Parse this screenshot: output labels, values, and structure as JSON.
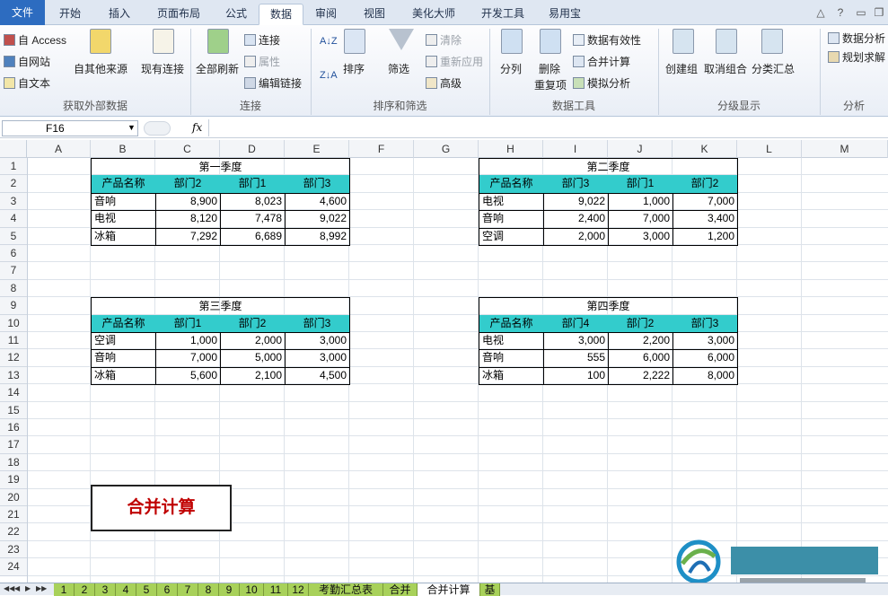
{
  "menu_tabs": [
    "文件",
    "开始",
    "插入",
    "页面布局",
    "公式",
    "数据",
    "审阅",
    "视图",
    "美化大师",
    "开发工具",
    "易用宝"
  ],
  "ribbon": {
    "ext": [
      "自 Access",
      "自网站",
      "自文本",
      "自其他来源",
      "现有连接"
    ],
    "conn": [
      "全部刷新",
      "连接",
      "属性",
      "编辑链接"
    ],
    "sort": [
      "排序",
      "筛选",
      "清除",
      "重新应用",
      "高级"
    ],
    "tools": [
      "分列",
      "删除",
      "重复项",
      "数据有效性",
      "合并计算",
      "模拟分析"
    ],
    "outline": [
      "创建组",
      "取消组合",
      "分类汇总"
    ],
    "analysis": [
      "数据分析",
      "规划求解"
    ],
    "groups": [
      "获取外部数据",
      "连接",
      "排序和筛选",
      "数据工具",
      "分级显示",
      "分析"
    ]
  },
  "name_box": "F16",
  "fx": "fx",
  "columns": [
    "A",
    "B",
    "C",
    "D",
    "E",
    "F",
    "G",
    "H",
    "I",
    "J",
    "K",
    "L",
    "M"
  ],
  "rows": [
    "1",
    "2",
    "3",
    "4",
    "5",
    "6",
    "7",
    "8",
    "9",
    "10",
    "11",
    "12",
    "13",
    "14",
    "15",
    "16",
    "17",
    "18",
    "19",
    "20",
    "21",
    "22",
    "23",
    "24"
  ],
  "tables": [
    {
      "title": "第一季度",
      "headers": [
        "产品名称",
        "部门2",
        "部门1",
        "部门3"
      ],
      "rows": [
        [
          "音响",
          "8,900",
          "8,023",
          "4,600"
        ],
        [
          "电视",
          "8,120",
          "7,478",
          "9,022"
        ],
        [
          "冰箱",
          "7,292",
          "6,689",
          "8,992"
        ]
      ]
    },
    {
      "title": "第二季度",
      "headers": [
        "产品名称",
        "部门3",
        "部门1",
        "部门2"
      ],
      "rows": [
        [
          "电视",
          "9,022",
          "1,000",
          "7,000"
        ],
        [
          "音响",
          "2,400",
          "7,000",
          "3,400"
        ],
        [
          "空调",
          "2,000",
          "3,000",
          "1,200"
        ]
      ]
    },
    {
      "title": "第三季度",
      "headers": [
        "产品名称",
        "部门1",
        "部门2",
        "部门3"
      ],
      "rows": [
        [
          "空调",
          "1,000",
          "2,000",
          "3,000"
        ],
        [
          "音响",
          "7,000",
          "5,000",
          "3,000"
        ],
        [
          "冰箱",
          "5,600",
          "2,100",
          "4,500"
        ]
      ]
    },
    {
      "title": "第四季度",
      "headers": [
        "产品名称",
        "部门4",
        "部门2",
        "部门3"
      ],
      "rows": [
        [
          "电视",
          "3,000",
          "2,200",
          "3,000"
        ],
        [
          "音响",
          "555",
          "6,000",
          "6,000"
        ],
        [
          "冰箱",
          "100",
          "2,222",
          "8,000"
        ]
      ]
    }
  ],
  "button_label": "合并计算",
  "sheet_tabs": [
    "1",
    "2",
    "3",
    "4",
    "5",
    "6",
    "7",
    "8",
    "9",
    "10",
    "11",
    "12",
    "考勤汇总表",
    "合并",
    "合并计算",
    "基"
  ]
}
